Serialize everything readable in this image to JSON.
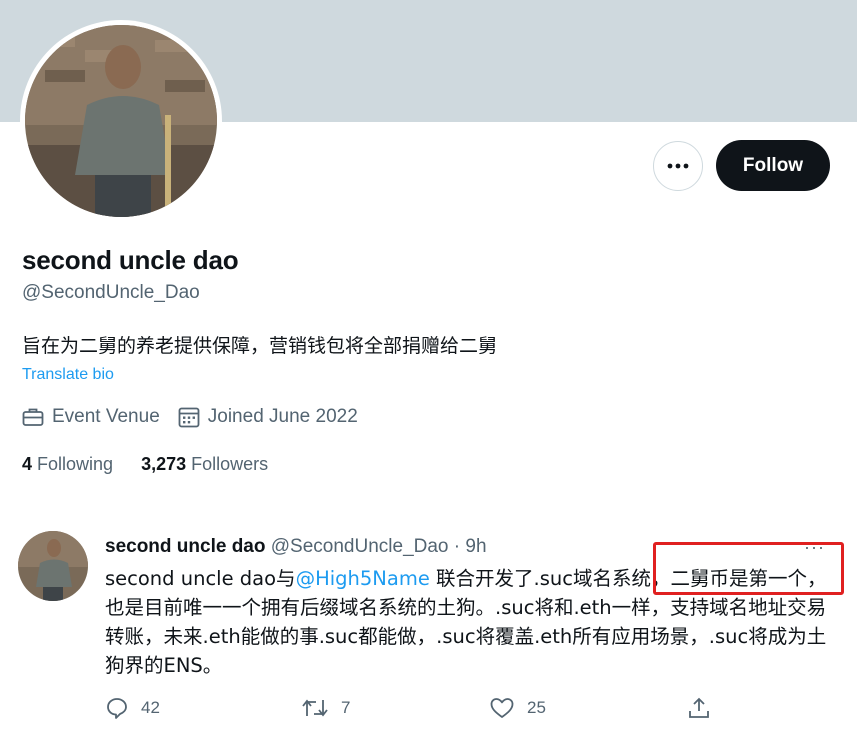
{
  "profile": {
    "display_name": "second uncle dao",
    "handle": "@SecondUncle_Dao",
    "bio": "旨在为二舅的养老提供保障，营销钱包将全部捐赠给二舅",
    "translate_label": "Translate bio",
    "location": "Event Venue",
    "joined": "Joined June 2022",
    "following_count": "4",
    "following_label": "Following",
    "followers_count": "3,273",
    "followers_label": "Followers",
    "follow_label": "Follow"
  },
  "tweet": {
    "author_name": "second uncle dao",
    "author_handle": "@SecondUncle_Dao",
    "time": "· 9h",
    "more_label": "···",
    "text_before": "second uncle dao与",
    "mention": "@High5Name",
    "text_after": " 联合开发了.suc域名系统，二舅币是第一个，也是目前唯一一个拥有后缀域名系统的土狗。.suc将和.eth一样，支持域名地址交易转账，未来.eth能做的事.suc都能做，.suc将覆盖.eth所有应用场景，.suc将成为土狗界的ENS。",
    "reply_count": "42",
    "retweet_count": "7",
    "like_count": "25"
  },
  "colors": {
    "banner": "#cfd9de",
    "accent": "#1d9bf0",
    "highlight_box": "#e02020",
    "follow_button": "#0f1419"
  },
  "icons": [
    "more-horizontal-icon",
    "briefcase-icon",
    "calendar-icon",
    "reply-icon",
    "retweet-icon",
    "like-icon",
    "share-icon"
  ]
}
